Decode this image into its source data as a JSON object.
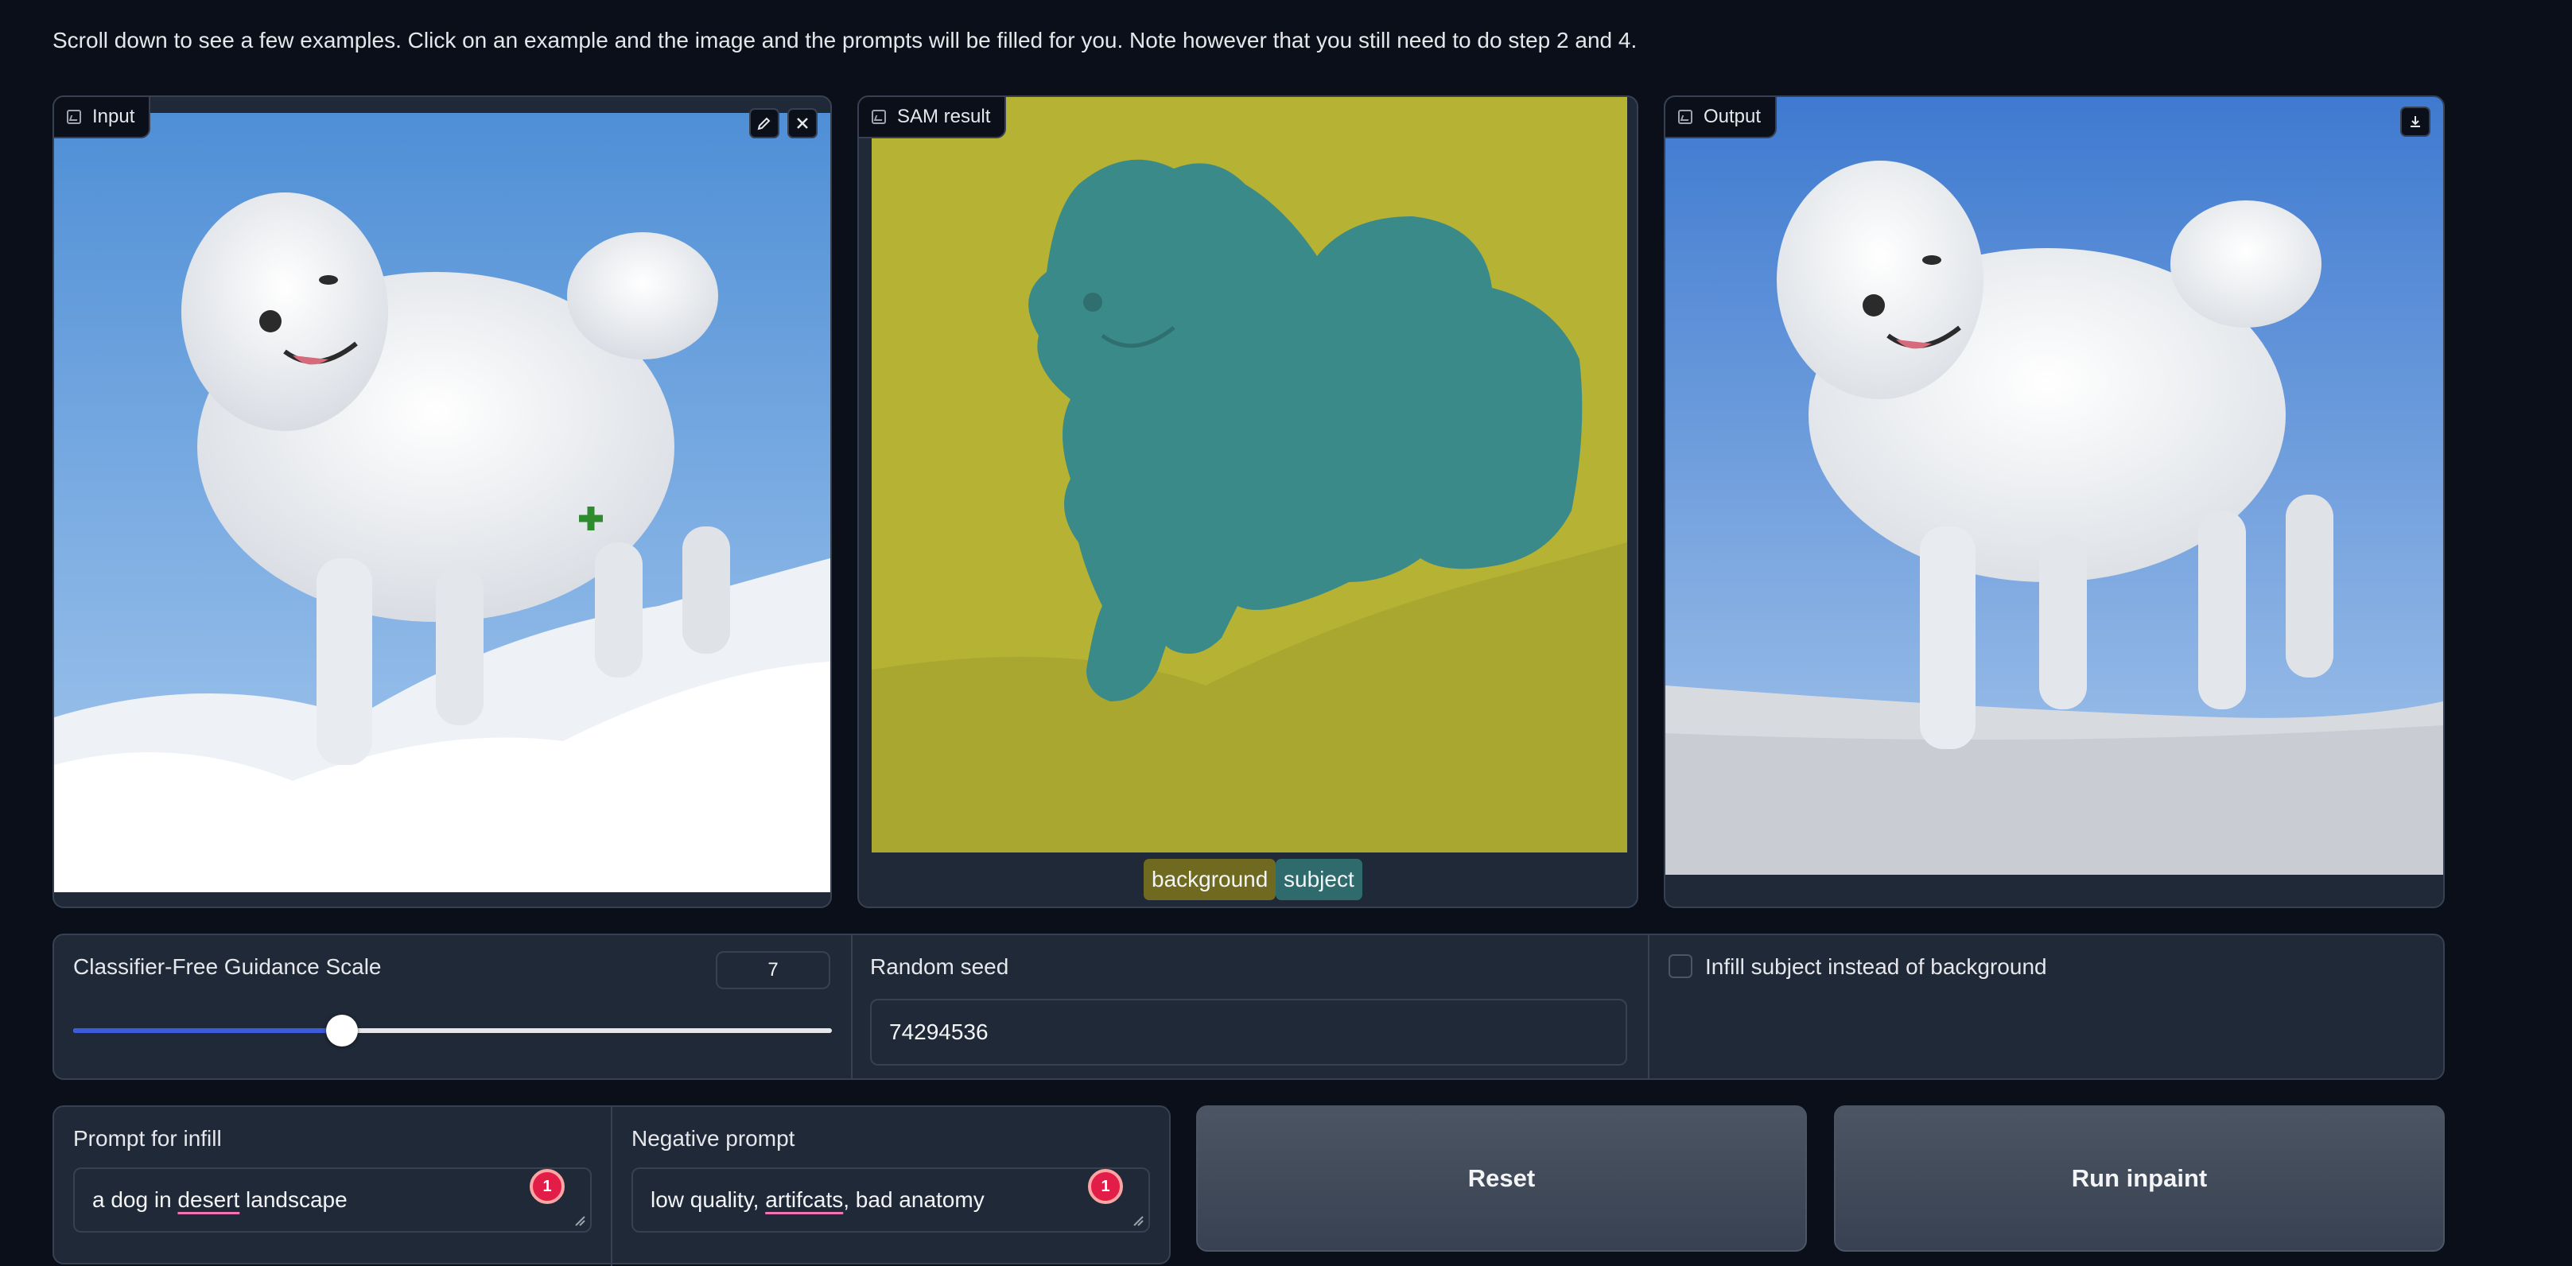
{
  "instructions": "Scroll down to see a few examples. Click on an example and the image and the prompts will be filled for you. Note however that you still need to do step 2 and 4.",
  "panels": {
    "input": {
      "label": "Input",
      "icon": "image-icon",
      "actions": [
        "edit-icon",
        "close-icon"
      ]
    },
    "sam": {
      "label": "SAM result",
      "icon": "image-icon",
      "legend": [
        {
          "label": "background",
          "color": "#b5b234"
        },
        {
          "label": "subject",
          "color": "#3b8a8a"
        }
      ]
    },
    "output": {
      "label": "Output",
      "icon": "image-icon",
      "actions": [
        "download-icon"
      ]
    }
  },
  "controls": {
    "cfg": {
      "label": "Classifier-Free Guidance Scale",
      "value": "7",
      "slider_fraction": 0.355
    },
    "seed": {
      "label": "Random seed",
      "value": "74294536"
    },
    "infill_subject": {
      "label": "Infill subject instead of background",
      "checked": false
    }
  },
  "prompts": {
    "infill": {
      "label": "Prompt for infill",
      "value_before": "a dog in ",
      "value_spell": "desert",
      "value_after": " landscape",
      "badge": "1"
    },
    "negative": {
      "label": "Negative prompt",
      "value_before": "low quality, ",
      "value_spell": "artifcats",
      "value_after": ", bad anatomy",
      "badge": "1"
    }
  },
  "buttons": {
    "reset": "Reset",
    "run": "Run inpaint"
  },
  "colors": {
    "background": "#0b0f19",
    "panel": "#1f2937",
    "border": "#374151",
    "slider_fill": "#3b5bdb",
    "sam_background": "#b5b234",
    "sam_subject": "#3b8a8a"
  }
}
